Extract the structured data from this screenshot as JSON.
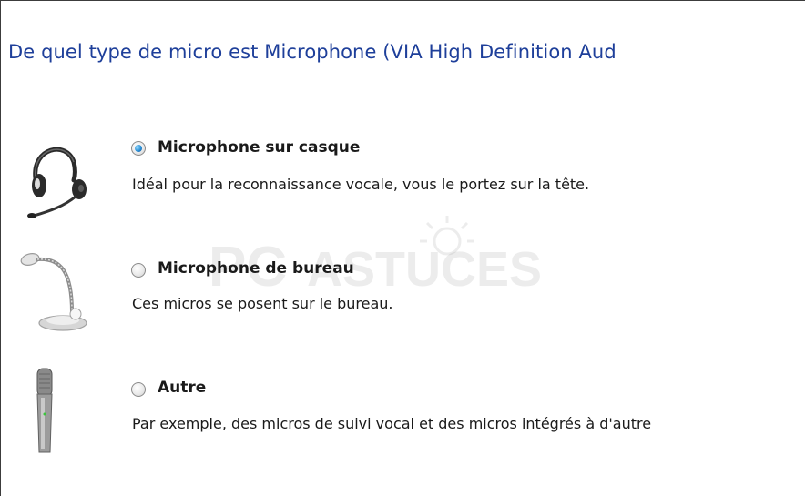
{
  "dialog": {
    "question": "De quel type de micro est Microphone (VIA High Definition Aud",
    "watermark": {
      "part1": "PC",
      "part2": "ASTUCES"
    },
    "options": [
      {
        "title": "Microphone sur casque",
        "description": "Idéal pour la reconnaissance vocale, vous le portez sur la tête.",
        "selected": true,
        "icon": "headset-icon"
      },
      {
        "title": "Microphone de bureau",
        "description": "Ces micros se posent sur le bureau.",
        "selected": false,
        "icon": "desk-microphone-icon"
      },
      {
        "title": "Autre",
        "description": "Par exemple, des micros de suivi vocal et des micros intégrés à d'autre",
        "selected": false,
        "icon": "handheld-microphone-icon"
      }
    ]
  },
  "colors": {
    "heading": "#1e3f9a",
    "radio_selected": "#2b8fd6"
  }
}
